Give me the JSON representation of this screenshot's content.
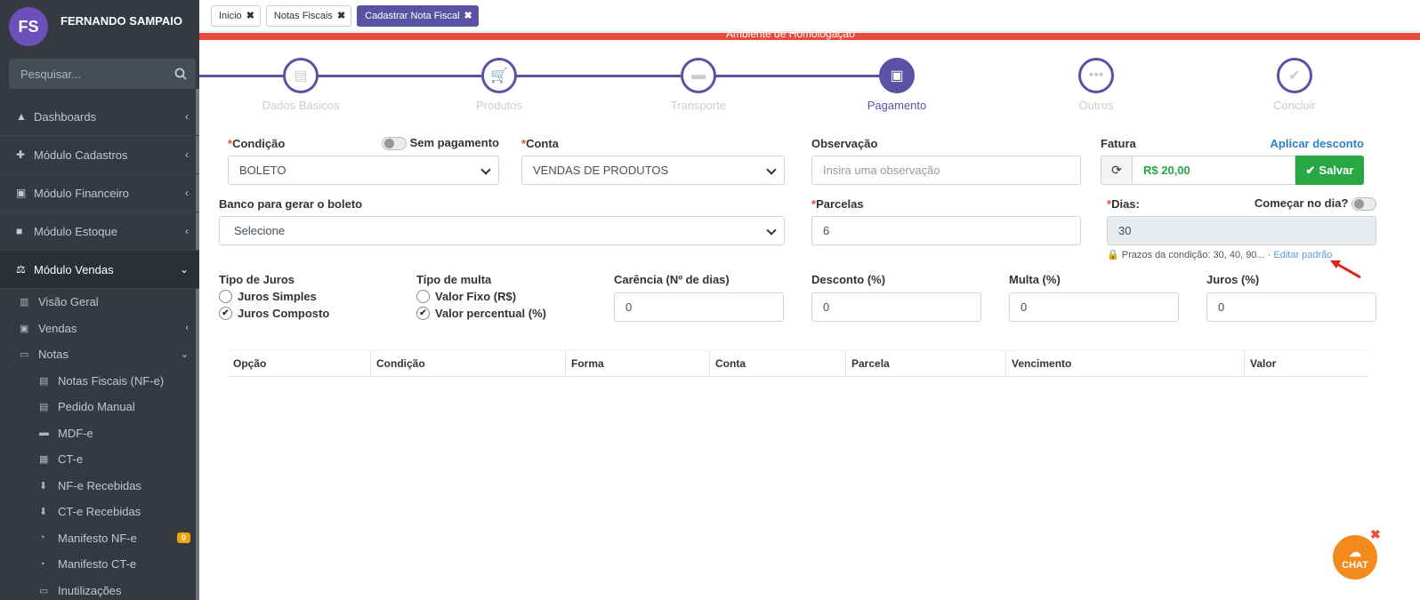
{
  "user": {
    "initials": "FS",
    "name": "FERNANDO SAMPAIO"
  },
  "search": {
    "placeholder": "Pesquisar..."
  },
  "menu": {
    "dashboards": "Dashboards",
    "cadastros": "Módulo Cadastros",
    "financeiro": "Módulo Financeiro",
    "estoque": "Módulo Estoque",
    "vendas": "Módulo Vendas",
    "visao": "Visão Geral",
    "vendas_sub": "Vendas",
    "notas": "Notas",
    "nfe": "Notas Fiscais (NF-e)",
    "pedido": "Pedido Manual",
    "mdfe": "MDF-e",
    "cte": "CT-e",
    "nfe_rec": "NF-e Recebidas",
    "cte_rec": "CT-e Recebidas",
    "manifesto_nfe": "Manifesto NF-e",
    "manifesto_nfe_badge": "0",
    "manifesto_cte": "Manifesto CT-e",
    "inutilizacoes": "Inutilizações"
  },
  "tabs": [
    "Inicio",
    "Notas Fiscais",
    "Cadastrar Nota Fiscal"
  ],
  "env": "Ambiente de Homologação",
  "steps": [
    "Dados Básicos",
    "Produtos",
    "Transporte",
    "Pagamento",
    "Outros",
    "Concluir"
  ],
  "form": {
    "condicao_label": "Condição",
    "sem_pagamento": "Sem pagamento",
    "condicao_value": "BOLETO",
    "conta_label": "Conta",
    "conta_value": "VENDAS DE PRODUTOS",
    "obs_label": "Observação",
    "obs_placeholder": "Insira uma observação",
    "fatura_label": "Fatura",
    "aplicar_desconto": "Aplicar desconto",
    "fatura_value": "R$ 20,00",
    "salvar": "Salvar",
    "banco_label": "Banco para gerar o boleto",
    "banco_value": "Selecione",
    "parcelas_label": "Parcelas",
    "parcelas_value": "6",
    "dias_label": "Dias:",
    "comecar_label": "Começar no dia?",
    "dias_value": "30",
    "prazos": "Prazos da condição: 30, 40, 90...",
    "editar": "Editar padrão",
    "tipo_juros": "Tipo de Juros",
    "juros_simples": "Juros Simples",
    "juros_composto": "Juros Composto",
    "tipo_multa": "Tipo de multa",
    "valor_fixo": "Valor Fixo (R$)",
    "valor_percentual": "Valor percentual (%)",
    "carencia_label": "Carência (Nº de dias)",
    "carencia_value": "0",
    "desconto_label": "Desconto (%)",
    "desconto_value": "0",
    "multa_label": "Multa (%)",
    "multa_value": "0",
    "juros_label": "Juros (%)",
    "juros_value": "0"
  },
  "table": {
    "headers": [
      "Opção",
      "Condição",
      "Forma",
      "Conta",
      "Parcela",
      "Vencimento",
      "Valor"
    ]
  },
  "chat": "CHAT"
}
